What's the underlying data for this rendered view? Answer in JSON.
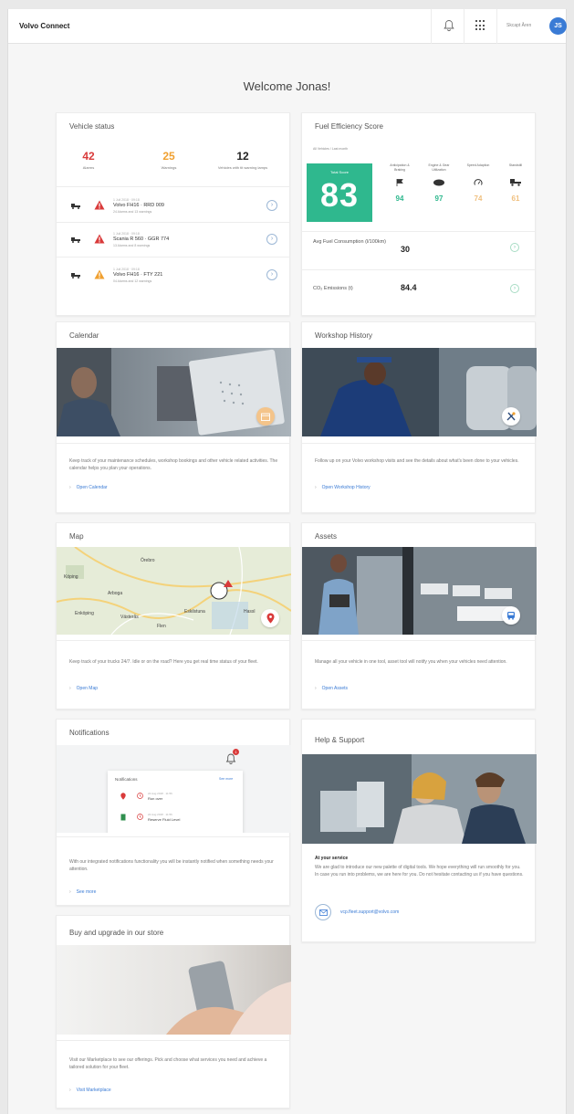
{
  "topbar": {
    "brand": "Volvo Connect",
    "user_name": "Skcapt Åren",
    "avatar_initials": "JS"
  },
  "welcome": "Welcome Jonas!",
  "vehicle_status": {
    "title": "Vehicle status",
    "stats": [
      {
        "value": "42",
        "label": "Alarms",
        "color": "#d93a3a"
      },
      {
        "value": "25",
        "label": "Warnings",
        "color": "#f0a030"
      },
      {
        "value": "12",
        "label": "Vehicles with tit warning lamps",
        "color": "#222222"
      }
    ],
    "vehicles": [
      {
        "date": "1 Juli 2018 · 09:18",
        "name": "Volvo FH16 · RRD 009",
        "sub": "24 Alarms and 13 warnings",
        "severity": "alarm"
      },
      {
        "date": "1 Juli 2018 · 09:18",
        "name": "Scania R 560 · GGR 774",
        "sub": "13 Alarms and 8 warnings",
        "severity": "alarm"
      },
      {
        "date": "1 Juli 2018 · 09:18",
        "name": "Volvo FH16 · FTY 221",
        "sub": "04 Alarms and 12 warnings",
        "severity": "warning"
      }
    ]
  },
  "fuel": {
    "title": "Fuel Efficiency Score",
    "scope": "All Vehicles / Last month",
    "total_label": "Total Score",
    "total_value": "83",
    "metrics": [
      {
        "label": "Anticipation & Braking",
        "value": "94",
        "color": "#2fb88e",
        "icon": "flag-icon"
      },
      {
        "label": "Engine & Gear Utilization",
        "value": "97",
        "color": "#2fb88e",
        "icon": "engine-icon"
      },
      {
        "label": "Speed Adaption",
        "value": "74",
        "color": "#f0c080",
        "icon": "speedometer-icon"
      },
      {
        "label": "Standstill",
        "value": "61",
        "color": "#f0c080",
        "icon": "truck-icon"
      }
    ],
    "rows": [
      {
        "label": "Avg Fuel Consumption (l/100km)",
        "value": "30"
      },
      {
        "label": "CO₂ Emissions (t)",
        "value": "84.4"
      }
    ]
  },
  "calendar": {
    "title": "Calendar",
    "desc": "Keep track of your maintenance schedules, workshop bookings and other vehicle related activities. The calendar helps you plan your operations.",
    "link": "Open Calendar"
  },
  "workshop": {
    "title": "Workshop History",
    "desc": "Follow up on your Volvo workshop visits and see the details about what's been done to your vehicles.",
    "link": "Open Workshop History"
  },
  "map": {
    "title": "Map",
    "desc": "Keep track of your trucks 24/7. Idle or on the road? Here you get real time status of your fleet.",
    "link": "Open Map",
    "places": [
      "Örebro",
      "Köping",
      "Arboga",
      "Enköping",
      "Västerås",
      "Hassl",
      "Eskilstuna",
      "Flen"
    ]
  },
  "assets": {
    "title": "Assets",
    "desc": "Manage all your vehicle in one tool, asset tool will notify you when your vehicles need attention.",
    "link": "Open Assets"
  },
  "notifications": {
    "title": "Notifications",
    "desc": "With our integrated notifications functionality you will be instantly notified when something needs your attention.",
    "link": "See more",
    "panel_title": "Notifications",
    "panel_link": "See more",
    "items": [
      {
        "time": "22 Aug 2018 · 11:56",
        "text": "Run over"
      },
      {
        "time": "22 Aug 2018 · 11:56",
        "text": "Reserve Fluid Level"
      }
    ],
    "badge": "1"
  },
  "help": {
    "title": "Help & Support",
    "heading": "At your service",
    "desc": "We are glad to introduce our new palette of digital tools. We hope everything will run smoothly for you. In case you run into problems, we are here for you. Do not hesitate contacting us if you have questions.",
    "email": "vcp.fleet.support@volvo.com"
  },
  "store": {
    "title": "Buy and upgrade in our store",
    "desc": "Visit our Marketplace to see our offerings. Pick and choose what services you need and achieve a tailored solution for your fleet.",
    "link": "Visit Marketplace"
  }
}
